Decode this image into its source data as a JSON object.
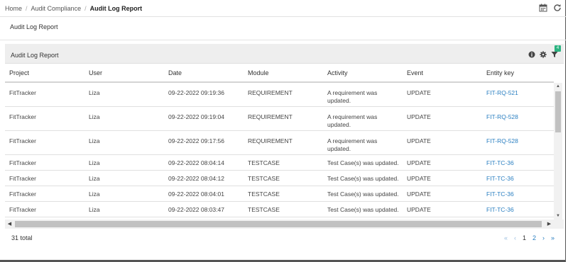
{
  "breadcrumb": {
    "home": "Home",
    "section": "Audit Compliance",
    "current": "Audit Log Report"
  },
  "top_icons": [
    "calendar-icon",
    "refresh-icon"
  ],
  "page_heading": "Audit Log Report",
  "panel": {
    "title": "Audit Log Report",
    "icons": [
      "info-icon",
      "gear-icon",
      "filter-icon"
    ],
    "filter_badge": "4"
  },
  "table": {
    "columns": [
      "Project",
      "User",
      "Date",
      "Module",
      "Activity",
      "Event",
      "Entity key"
    ],
    "rows": [
      {
        "project": "FitTracker",
        "user": "Liza",
        "date": "09-22-2022 09:19:36",
        "module": "REQUIREMENT",
        "activity_1": "A requirement was",
        "activity_2": "updated.",
        "event": "UPDATE",
        "key": "FIT-RQ-521"
      },
      {
        "project": "FitTracker",
        "user": "Liza",
        "date": "09-22-2022 09:19:04",
        "module": "REQUIREMENT",
        "activity_1": "A requirement was",
        "activity_2": "updated.",
        "event": "UPDATE",
        "key": "FIT-RQ-528"
      },
      {
        "project": "FitTracker",
        "user": "Liza",
        "date": "09-22-2022 09:17:56",
        "module": "REQUIREMENT",
        "activity_1": "A requirement was",
        "activity_2": "updated.",
        "event": "UPDATE",
        "key": "FIT-RQ-528"
      },
      {
        "project": "FitTracker",
        "user": "Liza",
        "date": "09-22-2022 08:04:14",
        "module": "TESTCASE",
        "activity_1": "Test Case(s) was updated.",
        "activity_2": "",
        "event": "UPDATE",
        "key": "FIT-TC-36"
      },
      {
        "project": "FitTracker",
        "user": "Liza",
        "date": "09-22-2022 08:04:12",
        "module": "TESTCASE",
        "activity_1": "Test Case(s) was updated.",
        "activity_2": "",
        "event": "UPDATE",
        "key": "FIT-TC-36"
      },
      {
        "project": "FitTracker",
        "user": "Liza",
        "date": "09-22-2022 08:04:01",
        "module": "TESTCASE",
        "activity_1": "Test Case(s) was updated.",
        "activity_2": "",
        "event": "UPDATE",
        "key": "FIT-TC-36"
      },
      {
        "project": "FitTracker",
        "user": "Liza",
        "date": "09-22-2022 08:03:47",
        "module": "TESTCASE",
        "activity_1": "Test Case(s) was updated.",
        "activity_2": "",
        "event": "UPDATE",
        "key": "FIT-TC-36"
      }
    ]
  },
  "footer": {
    "total": "31 total",
    "pages": [
      "1",
      "2"
    ],
    "current_page": "1"
  },
  "colors": {
    "link": "#2a7fc1",
    "badge": "#2bb380",
    "panel_bg": "#eeeeee"
  }
}
